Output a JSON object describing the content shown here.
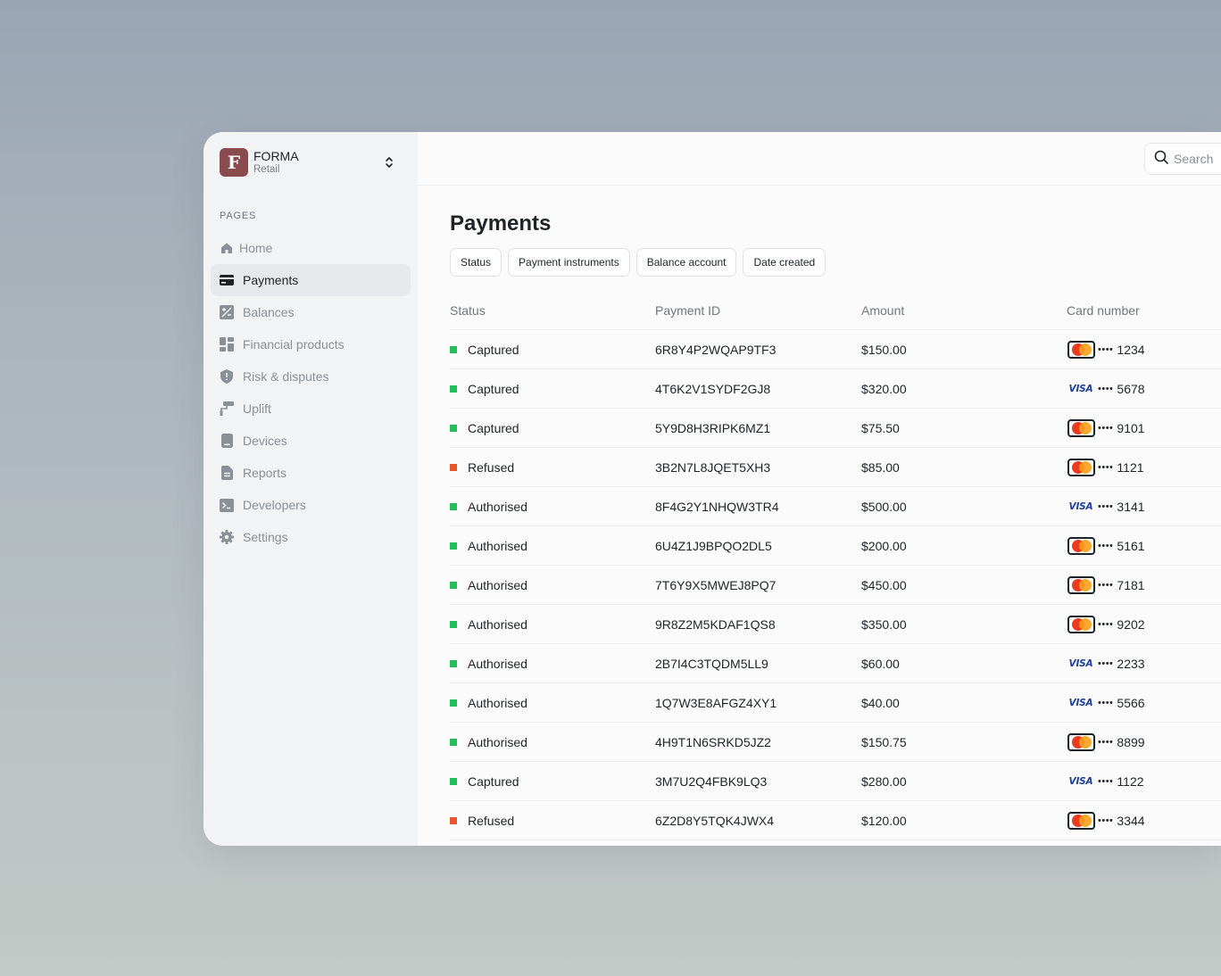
{
  "brand": {
    "logo_letter": "F",
    "name": "FORMA",
    "subtitle": "Retail"
  },
  "sidebar": {
    "section_label": "PAGES",
    "items": [
      {
        "label": "Home",
        "icon": "home-icon"
      },
      {
        "label": "Payments",
        "icon": "credit-card-icon",
        "active": true
      },
      {
        "label": "Balances",
        "icon": "balance-icon"
      },
      {
        "label": "Financial products",
        "icon": "grid-icon"
      },
      {
        "label": "Risk & disputes",
        "icon": "shield-icon"
      },
      {
        "label": "Uplift",
        "icon": "paint-roller-icon"
      },
      {
        "label": "Devices",
        "icon": "device-icon"
      },
      {
        "label": "Reports",
        "icon": "document-icon"
      },
      {
        "label": "Developers",
        "icon": "terminal-icon"
      },
      {
        "label": "Settings",
        "icon": "gear-icon"
      }
    ]
  },
  "search": {
    "placeholder": "Search"
  },
  "page_title": "Payments",
  "filters": [
    "Status",
    "Payment instruments",
    "Balance account",
    "Date created"
  ],
  "table": {
    "columns": [
      "Status",
      "Payment ID",
      "Amount",
      "Card number"
    ],
    "rows": [
      {
        "status": "Captured",
        "id": "6R8Y4P2WQAP9TF3",
        "amount": "$150.00",
        "card_brand": "mastercard",
        "dots": "••••",
        "last4": "1234"
      },
      {
        "status": "Captured",
        "id": "4T6K2V1SYDF2GJ8",
        "amount": "$320.00",
        "card_brand": "visa",
        "dots": "••••",
        "last4": "5678"
      },
      {
        "status": "Captured",
        "id": "5Y9D8H3RIPK6MZ1",
        "amount": "$75.50",
        "card_brand": "mastercard",
        "dots": "••••",
        "last4": "9101"
      },
      {
        "status": "Refused",
        "id": "3B2N7L8JQET5XH3",
        "amount": "$85.00",
        "card_brand": "mastercard",
        "dots": "••••",
        "last4": "1121"
      },
      {
        "status": "Authorised",
        "id": "8F4G2Y1NHQW3TR4",
        "amount": "$500.00",
        "card_brand": "visa",
        "dots": "••••",
        "last4": "3141"
      },
      {
        "status": "Authorised",
        "id": "6U4Z1J9BPQO2DL5",
        "amount": "$200.00",
        "card_brand": "mastercard",
        "dots": "••••",
        "last4": "5161"
      },
      {
        "status": "Authorised",
        "id": "7T6Y9X5MWEJ8PQ7",
        "amount": "$450.00",
        "card_brand": "mastercard",
        "dots": "••••",
        "last4": "7181"
      },
      {
        "status": "Authorised",
        "id": "9R8Z2M5KDAF1QS8",
        "amount": "$350.00",
        "card_brand": "mastercard",
        "dots": "••••",
        "last4": "9202"
      },
      {
        "status": "Authorised",
        "id": "2B7I4C3TQDM5LL9",
        "amount": "$60.00",
        "card_brand": "visa",
        "dots": "••••",
        "last4": "2233"
      },
      {
        "status": "Authorised",
        "id": "1Q7W3E8AFGZ4XY1",
        "amount": "$40.00",
        "card_brand": "visa",
        "dots": "••••",
        "last4": "5566"
      },
      {
        "status": "Authorised",
        "id": "4H9T1N6SRKD5JZ2",
        "amount": "$150.75",
        "card_brand": "mastercard",
        "dots": "••••",
        "last4": "8899"
      },
      {
        "status": "Captured",
        "id": "3M7U2Q4FBK9LQ3",
        "amount": "$280.00",
        "card_brand": "visa",
        "dots": "••••",
        "last4": "1122"
      },
      {
        "status": "Refused",
        "id": "6Z2D8Y5TQK4JWX4",
        "amount": "$120.00",
        "card_brand": "mastercard",
        "dots": "••••",
        "last4": "3344"
      }
    ]
  },
  "card_brand_labels": {
    "visa": "VISA"
  },
  "colors": {
    "status_ok": "#1fbf5a",
    "status_refused": "#e8572a",
    "logo_bg": "#8a4b4e",
    "active_nav_bg": "#e6e8eb"
  }
}
